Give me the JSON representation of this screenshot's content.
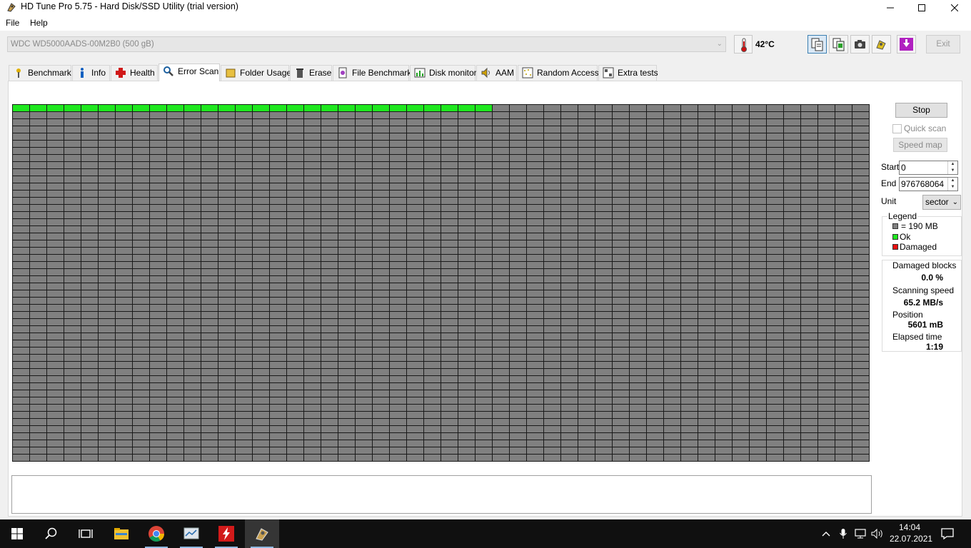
{
  "window": {
    "title": "HD Tune Pro 5.75 - Hard Disk/SSD Utility (trial version)",
    "minimize_icon": "minimize-icon",
    "maximize_icon": "maximize-icon",
    "close_icon": "close-icon"
  },
  "menu": {
    "file": "File",
    "help": "Help"
  },
  "toolbar": {
    "drive": "WDC WD5000AADS-00M2B0 (500 gB)",
    "temperature": "42°C",
    "exit_label": "Exit",
    "icons": [
      "copy-text-icon",
      "copy-info-icon",
      "screenshot-icon",
      "options-icon",
      "save-icon"
    ]
  },
  "tabs": [
    {
      "label": "Benchmark",
      "icon": "benchmark-icon"
    },
    {
      "label": "Info",
      "icon": "info-icon"
    },
    {
      "label": "Health",
      "icon": "health-icon"
    },
    {
      "label": "Error Scan",
      "icon": "error-scan-icon",
      "active": true
    },
    {
      "label": "Folder Usage",
      "icon": "folder-usage-icon"
    },
    {
      "label": "Erase",
      "icon": "erase-icon"
    },
    {
      "label": "File Benchmark",
      "icon": "file-benchmark-icon"
    },
    {
      "label": "Disk monitor",
      "icon": "disk-monitor-icon"
    },
    {
      "label": "AAM",
      "icon": "aam-icon"
    },
    {
      "label": "Random Access",
      "icon": "random-access-icon"
    },
    {
      "label": "Extra tests",
      "icon": "extra-tests-icon"
    }
  ],
  "scan": {
    "columns": 50,
    "rows": 50,
    "ok_blocks": 28,
    "colors": {
      "ok": "#1fe81f",
      "pending": "#808080",
      "damaged": "#e81010",
      "grid_line": "#1a1a1a"
    }
  },
  "controls": {
    "stop_label": "Stop",
    "quick_scan_label": "Quick scan",
    "quick_scan_checked": false,
    "speed_map_label": "Speed map",
    "start_label": "Start",
    "start_value": "0",
    "end_label": "End",
    "end_value": "976768064",
    "unit_label": "Unit",
    "unit_value": "sector"
  },
  "legend": {
    "title": "Legend",
    "block_size": "= 190 MB",
    "ok": "Ok",
    "damaged": "Damaged"
  },
  "stats": {
    "damaged_blocks_label": "Damaged blocks",
    "damaged_blocks_value": "0.0 %",
    "scanning_speed_label": "Scanning speed",
    "scanning_speed_value": "65.2 MB/s",
    "position_label": "Position",
    "position_value": "5601 mB",
    "elapsed_time_label": "Elapsed time",
    "elapsed_time_value": "1:19"
  },
  "taskbar": {
    "apps": [
      "start-icon",
      "search-icon",
      "task-view-icon",
      "file-explorer-icon",
      "chrome-icon",
      "disk-utility-icon",
      "flash-app-icon",
      "hd-tune-icon"
    ],
    "time": "14:04",
    "date": "22.07.2021"
  }
}
